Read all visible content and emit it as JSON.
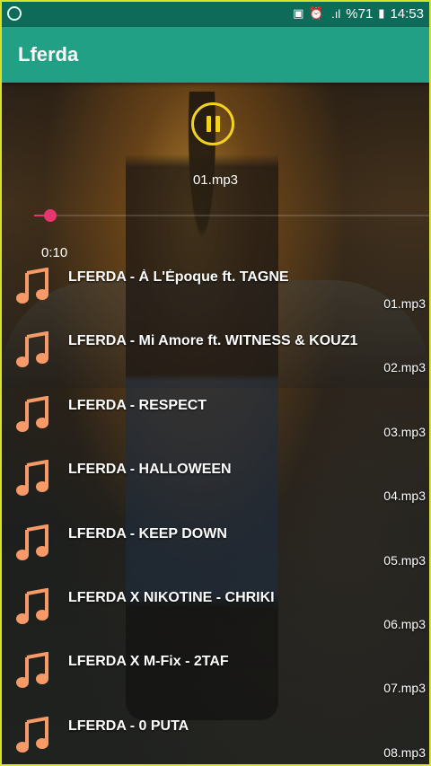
{
  "status_bar": {
    "battery_percent": "%71",
    "time": "14:53"
  },
  "app_bar": {
    "title": "Lferda"
  },
  "player": {
    "now_playing": "01.mp3",
    "elapsed": "0:10",
    "progress_fraction": 0.04,
    "accent": "#e7356f",
    "button_color": "#f2d21a"
  },
  "tracks": [
    {
      "title": "LFERDA - À L'Époque ft. TAGNE",
      "file": "01.mp3"
    },
    {
      "title": "LFERDA - Mi Amore ft. WITNESS & KOUZ1",
      "file": "02.mp3"
    },
    {
      "title": "LFERDA - RESPECT",
      "file": "03.mp3"
    },
    {
      "title": "LFERDA - HALLOWEEN",
      "file": "04.mp3"
    },
    {
      "title": "LFERDA - KEEP DOWN",
      "file": "05.mp3"
    },
    {
      "title": "LFERDA X NIKOTINE - CHRIKI",
      "file": "06.mp3"
    },
    {
      "title": "LFERDA X M-Fix - 2TAF",
      "file": "07.mp3"
    },
    {
      "title": "LFERDA - 0 PUTA",
      "file": "08.mp3"
    }
  ],
  "icons": {
    "track": "music-note-icon",
    "play_state": "pause-icon"
  },
  "colors": {
    "status_bar": "#0f6b59",
    "app_bar": "#21a085",
    "note_icon": "#f79a67"
  }
}
